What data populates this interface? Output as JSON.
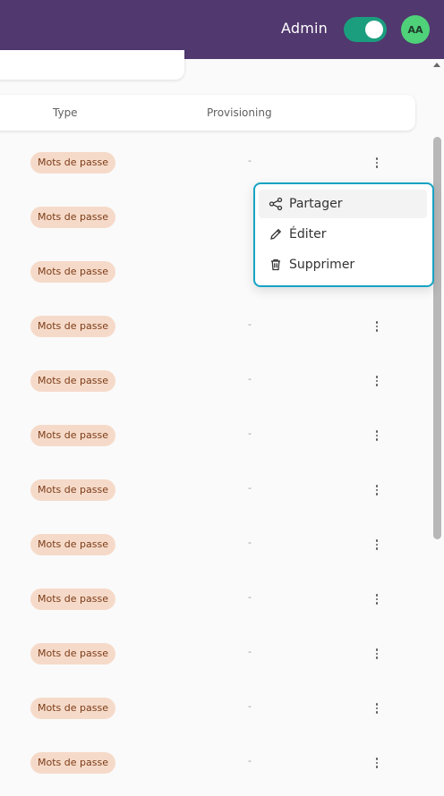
{
  "header": {
    "role_label": "Admin",
    "admin_toggle_on": true,
    "avatar_initials": "AA",
    "colors": {
      "bar": "#51386e",
      "toggle": "#1b9e7e",
      "avatar": "#4fd17a"
    }
  },
  "table": {
    "columns": {
      "type": "Type",
      "provisioning": "Provisioning"
    },
    "rows": [
      {
        "type": "Mots de passe",
        "provisioning": "-"
      },
      {
        "type": "Mots de passe",
        "provisioning": "-"
      },
      {
        "type": "Mots de passe",
        "provisioning": "-"
      },
      {
        "type": "Mots de passe",
        "provisioning": "-"
      },
      {
        "type": "Mots de passe",
        "provisioning": "-"
      },
      {
        "type": "Mots de passe",
        "provisioning": "-"
      },
      {
        "type": "Mots de passe",
        "provisioning": "-"
      },
      {
        "type": "Mots de passe",
        "provisioning": "-"
      },
      {
        "type": "Mots de passe",
        "provisioning": "-"
      },
      {
        "type": "Mots de passe",
        "provisioning": "-"
      },
      {
        "type": "Mots de passe",
        "provisioning": "-"
      },
      {
        "type": "Mots de passe",
        "provisioning": "-"
      }
    ],
    "row_action_icon": "kebab-icon"
  },
  "context_menu": {
    "items": [
      {
        "label": "Partager",
        "icon": "share-icon"
      },
      {
        "label": "Éditer",
        "icon": "pencil-icon"
      },
      {
        "label": "Supprimer",
        "icon": "trash-icon"
      }
    ],
    "accent_color": "#15a3c4"
  }
}
